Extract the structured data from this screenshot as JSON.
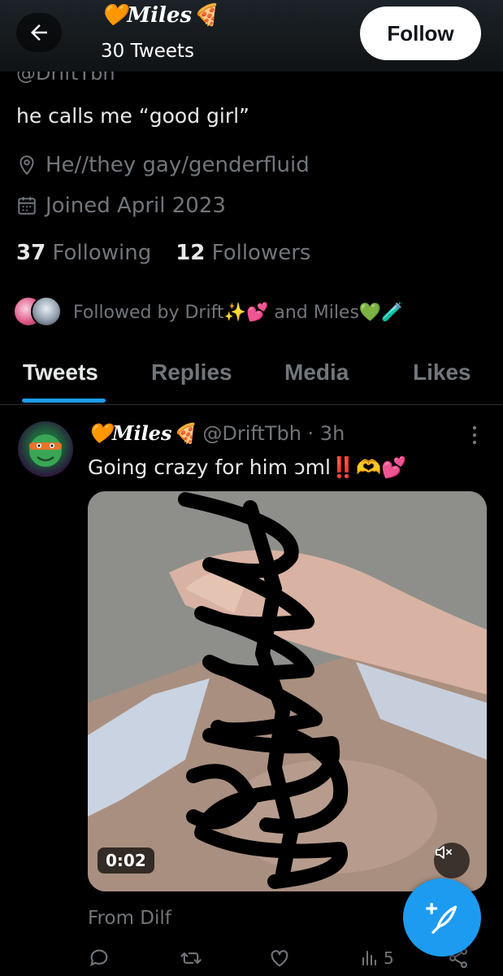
{
  "header": {
    "display_name": "🧡Miles🍕",
    "tweet_count": "30 Tweets",
    "follow_label": "Follow",
    "back_icon": "arrow-left-icon"
  },
  "profile": {
    "handle_partial": "@DriftTbh",
    "bio": "he calls me “good girl”",
    "location": "He//they gay/genderfluid",
    "joined": "Joined April 2023",
    "following_count": "37",
    "following_label": "Following",
    "followers_count": "12",
    "followers_label": "Followers",
    "followed_by": "Followed by Drift✨💕 and Miles💚🧪"
  },
  "tabs": [
    {
      "label": "Tweets",
      "active": true
    },
    {
      "label": "Replies",
      "active": false
    },
    {
      "label": "Media",
      "active": false
    },
    {
      "label": "Likes",
      "active": false
    }
  ],
  "tweet": {
    "display_name": "🧡Miles🍕",
    "handle_time": "@DriftTbh · 3h",
    "text": "Going crazy for him ɔml‼️🫶💕",
    "video_duration": "0:02",
    "source": "From Dilf",
    "views": "5"
  },
  "colors": {
    "accent": "#1d9bf0",
    "background": "#000000",
    "secondary_text": "#71767b"
  }
}
